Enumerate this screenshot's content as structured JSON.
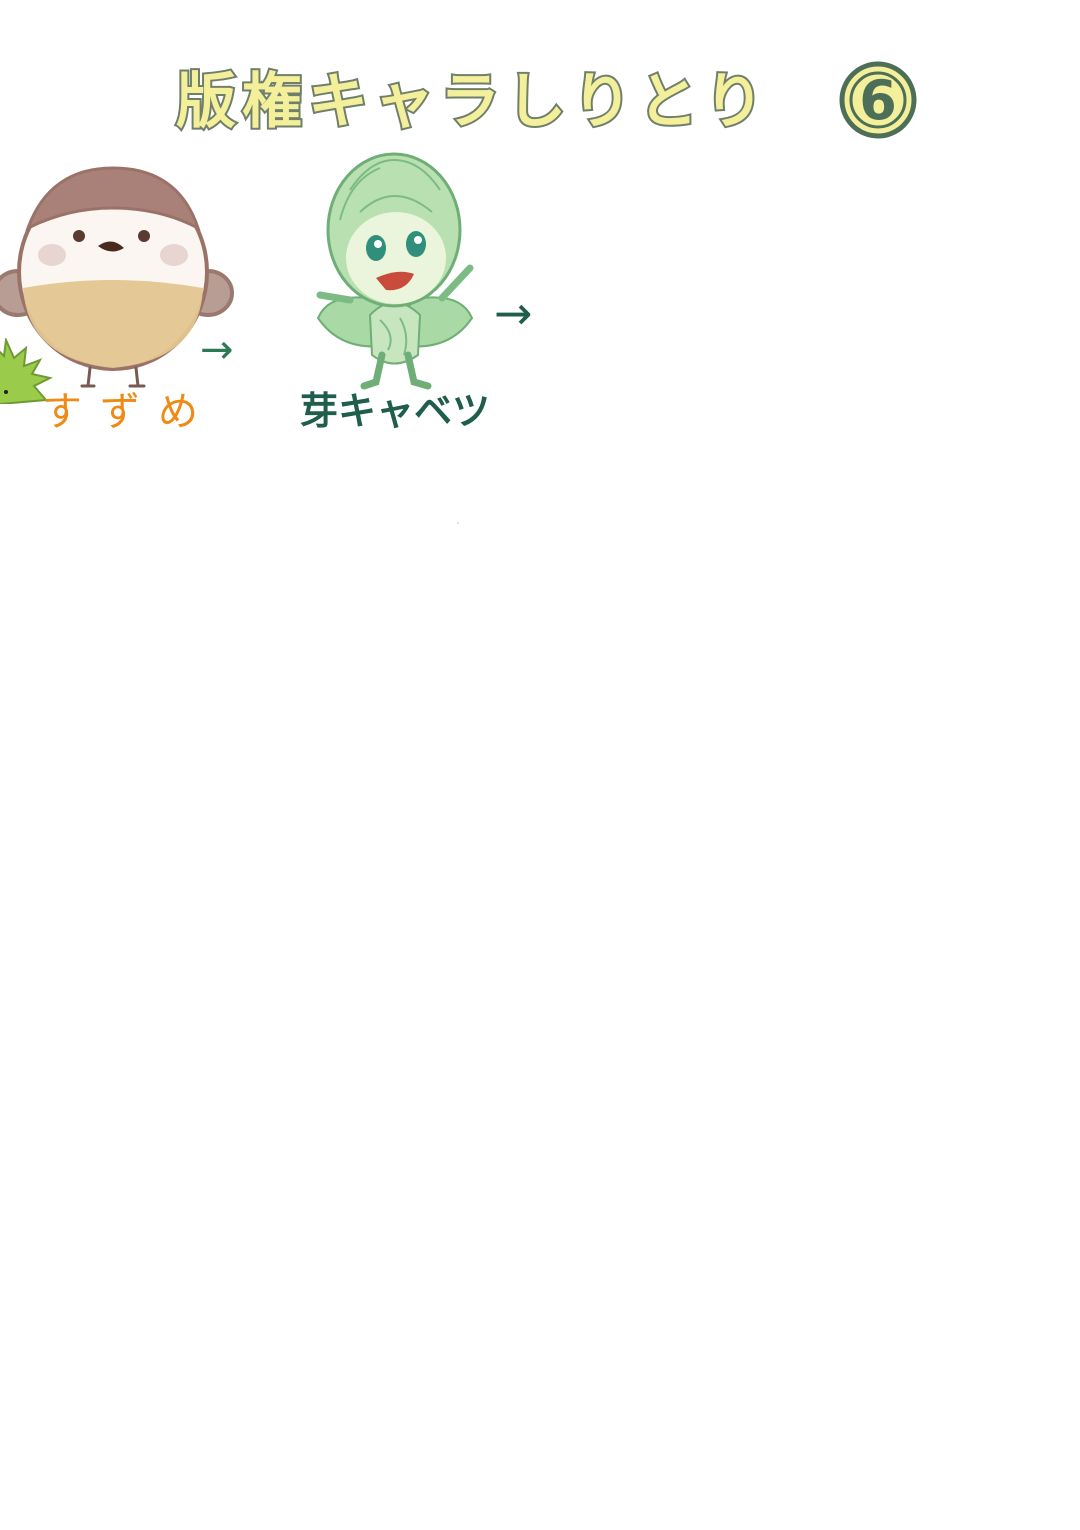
{
  "title": {
    "text": "版権キャラしりとり",
    "number": "6"
  },
  "chain": [
    {
      "name": "すずめ",
      "icon": "sparrow-illustration",
      "color": "#f08a16"
    },
    {
      "name": "芽キャベツ",
      "icon": "sprout-cabbage-illustration",
      "color": "#1f5e4c"
    }
  ],
  "arrows": {
    "symbol": "→"
  },
  "colors": {
    "title_fill": "#f3ef9a",
    "title_outline": "#6f7f6a",
    "sparrow_label": "#f08a16",
    "cabbage_label": "#1f5e4c",
    "arrow_green": "#2a7a55"
  }
}
